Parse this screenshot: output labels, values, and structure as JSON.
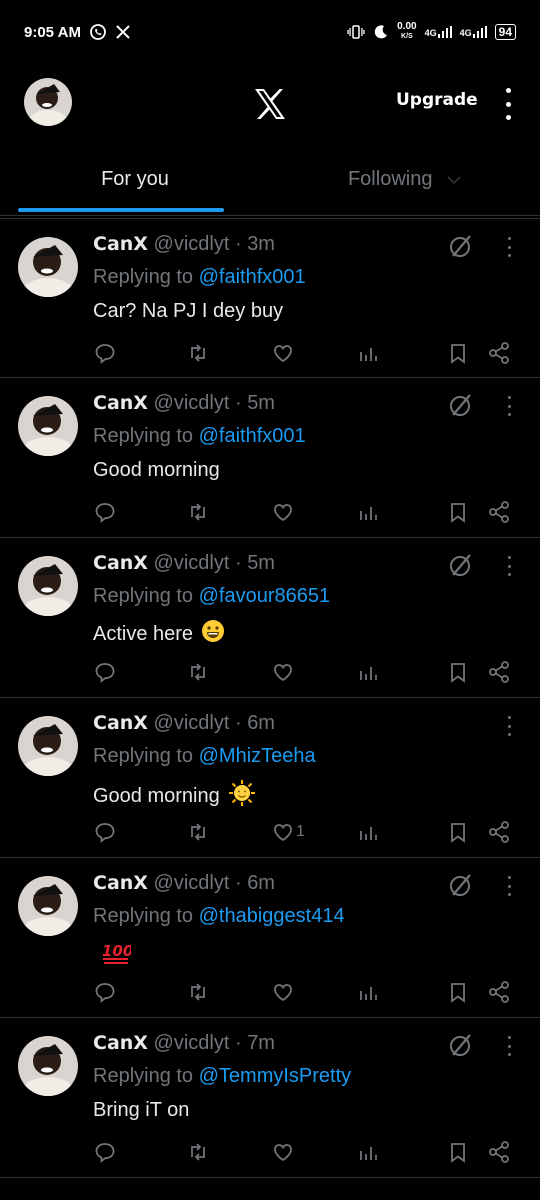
{
  "status_bar": {
    "time": "9:05 AM",
    "net_speed_value": "0.00",
    "net_speed_unit": "K/S",
    "sim1": "4G",
    "sim2": "4G",
    "battery": "94"
  },
  "header": {
    "upgrade_label": "Upgrade"
  },
  "tabs": [
    {
      "label": "For you",
      "active": true
    },
    {
      "label": "Following",
      "active": false
    }
  ],
  "tweets": [
    {
      "name": "CanX",
      "handle": "@vicdlyt",
      "sep": "·",
      "time": "3m",
      "replying_prefix": "Replying to",
      "replying_to": "@faithfx001",
      "text": "Car? Na PJ I dey buy",
      "emoji": "",
      "likes": "",
      "grok": true
    },
    {
      "name": "CanX",
      "handle": "@vicdlyt",
      "sep": "·",
      "time": "5m",
      "replying_prefix": "Replying to",
      "replying_to": "@faithfx001",
      "text": "Good morning",
      "emoji": "",
      "likes": "",
      "grok": true
    },
    {
      "name": "CanX",
      "handle": "@vicdlyt",
      "sep": "·",
      "time": "5m",
      "replying_prefix": "Replying to",
      "replying_to": "@favour86651",
      "text": "Active here",
      "emoji": "grinning-face",
      "likes": "",
      "grok": true
    },
    {
      "name": "CanX",
      "handle": "@vicdlyt",
      "sep": "·",
      "time": "6m",
      "replying_prefix": "Replying to",
      "replying_to": "@MhizTeeha",
      "text": "Good morning",
      "emoji": "sun-with-face",
      "likes": "1",
      "grok": false
    },
    {
      "name": "CanX",
      "handle": "@vicdlyt",
      "sep": "·",
      "time": "6m",
      "replying_prefix": "Replying to",
      "replying_to": "@thabiggest414",
      "text": "",
      "emoji": "hundred-points",
      "likes": "",
      "grok": true
    },
    {
      "name": "CanX",
      "handle": "@vicdlyt",
      "sep": "·",
      "time": "7m",
      "replying_prefix": "Replying to",
      "replying_to": "@TemmyIsPretty",
      "text": "Bring iT on",
      "emoji": "",
      "likes": "",
      "grok": true
    }
  ],
  "colors": {
    "background": "#000000",
    "accent": "#1d9bf0",
    "muted": "#71767b",
    "text": "#e7e9ea"
  },
  "icons": [
    "alarm-icon",
    "whatsapp-icon",
    "x-icon",
    "vibrate-icon",
    "moon-icon",
    "signal-icon",
    "battery-icon",
    "grok-icon",
    "reply-icon",
    "retweet-icon",
    "like-icon",
    "views-icon",
    "bookmark-icon",
    "share-icon"
  ]
}
